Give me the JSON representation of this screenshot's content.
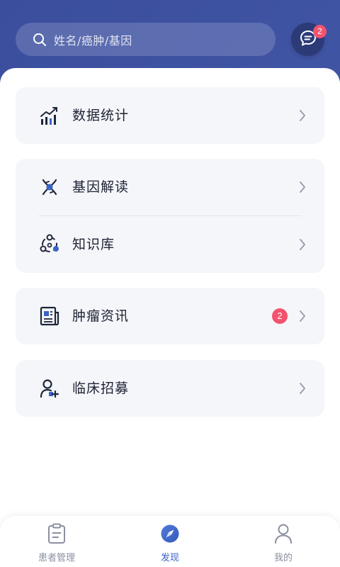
{
  "search": {
    "placeholder": "姓名/癌肿/基因"
  },
  "header": {
    "message_badge": "2"
  },
  "menu": {
    "stats": {
      "label": "数据统计"
    },
    "gene": {
      "label": "基因解读"
    },
    "knowledge": {
      "label": "知识库"
    },
    "news": {
      "label": "肿瘤资讯",
      "badge": "2"
    },
    "trial": {
      "label": "临床招募"
    }
  },
  "tabs": [
    {
      "label": "患者管理",
      "icon": "clipboard-icon"
    },
    {
      "label": "发现",
      "icon": "discover-compass-icon",
      "active": true
    },
    {
      "label": "我的",
      "icon": "person-icon"
    }
  ],
  "colors": {
    "header_bg": "#4256a6",
    "accent": "#3a63c7",
    "badge": "#f2536f",
    "card_bg": "#f4f6fa"
  }
}
